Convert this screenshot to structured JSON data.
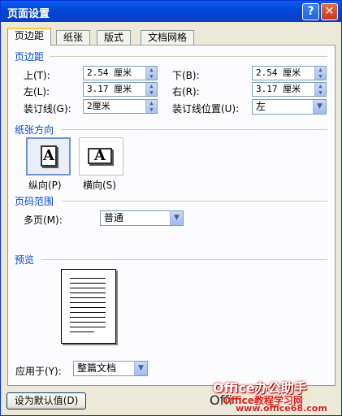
{
  "window": {
    "title": "页面设置",
    "help_icon": "question-mark-icon",
    "close_icon": "close-icon"
  },
  "tabs": [
    {
      "label": "页边距",
      "active": true
    },
    {
      "label": "纸张",
      "active": false
    },
    {
      "label": "版式",
      "active": false
    },
    {
      "label": "文档网格",
      "active": false
    }
  ],
  "margins": {
    "section_title": "页边距",
    "top_label": "上(T):",
    "top_value": "2.54 厘米",
    "bottom_label": "下(B):",
    "bottom_value": "2.54 厘米",
    "left_label": "左(L):",
    "left_value": "3.17 厘米",
    "right_label": "右(R):",
    "right_value": "3.17 厘米",
    "gutter_label": "装订线(G):",
    "gutter_value": "2厘米",
    "gutter_pos_label": "装订线位置(U):",
    "gutter_pos_value": "左"
  },
  "orientation": {
    "section_title": "纸张方向",
    "portrait_label": "纵向(P)",
    "landscape_label": "横向(S)",
    "icon_letter": "A",
    "selected": "portrait"
  },
  "pages": {
    "section_title": "页码范围",
    "multiple_label": "多页(M):",
    "multiple_value": "普通"
  },
  "preview": {
    "section_title": "预览",
    "apply_label": "应用于(Y):",
    "apply_value": "整篇文档"
  },
  "footer": {
    "default_button": "设为默认值(D)"
  },
  "watermark": {
    "brand": "Office办公助手",
    "site": "Office教程学习网",
    "url": "www.office68.com"
  },
  "colors": {
    "title_bar": "#0a5ef0",
    "group_title": "#0046d5",
    "tab_highlight": "#ffc83c",
    "close_button": "#c43a18"
  }
}
